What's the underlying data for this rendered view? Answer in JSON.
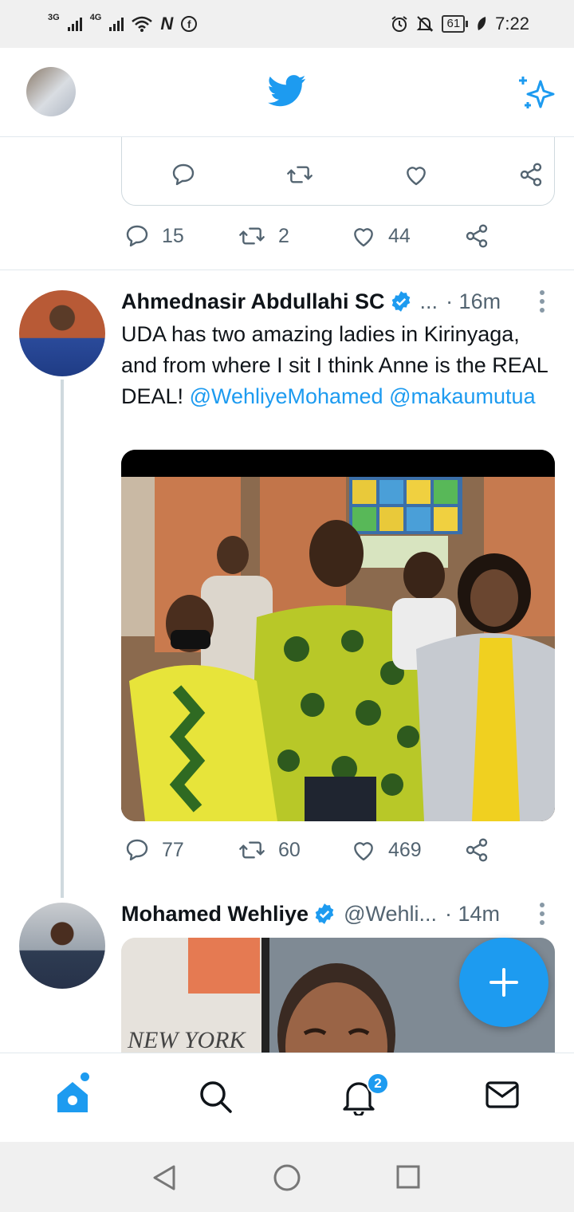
{
  "status_bar": {
    "net1": "3G",
    "net2": "4G",
    "icon_n": "N",
    "icon_fb": "f",
    "battery": "61",
    "time": "7:22"
  },
  "header": {
    "logo_icon": "twitter-bird-icon",
    "sparkle_icon": "sparkle-icon"
  },
  "tweets": [
    {
      "reply_count": "15",
      "retweet_count": "2",
      "like_count": "44"
    },
    {
      "name": "Ahmednasir Abdullahi SC",
      "handle_truncated": "...",
      "time": "· 16m",
      "text_plain": "UDA has two amazing ladies in Kirinyaga, and from where I sit I think Anne is the REAL DEAL!",
      "mention1": "@WehliyeMohamed",
      "mention2": "@makaumutua",
      "reply_count": "77",
      "retweet_count": "60",
      "like_count": "469"
    },
    {
      "name": "Mohamed Wehliye",
      "handle": "@Wehli...",
      "time": "· 14m",
      "image_caption": "NEW YORK"
    }
  ],
  "bottom_nav": {
    "notifications_badge": "2"
  },
  "colors": {
    "accent": "#1d9bf0",
    "text": "#0f1419",
    "muted": "#536471"
  }
}
